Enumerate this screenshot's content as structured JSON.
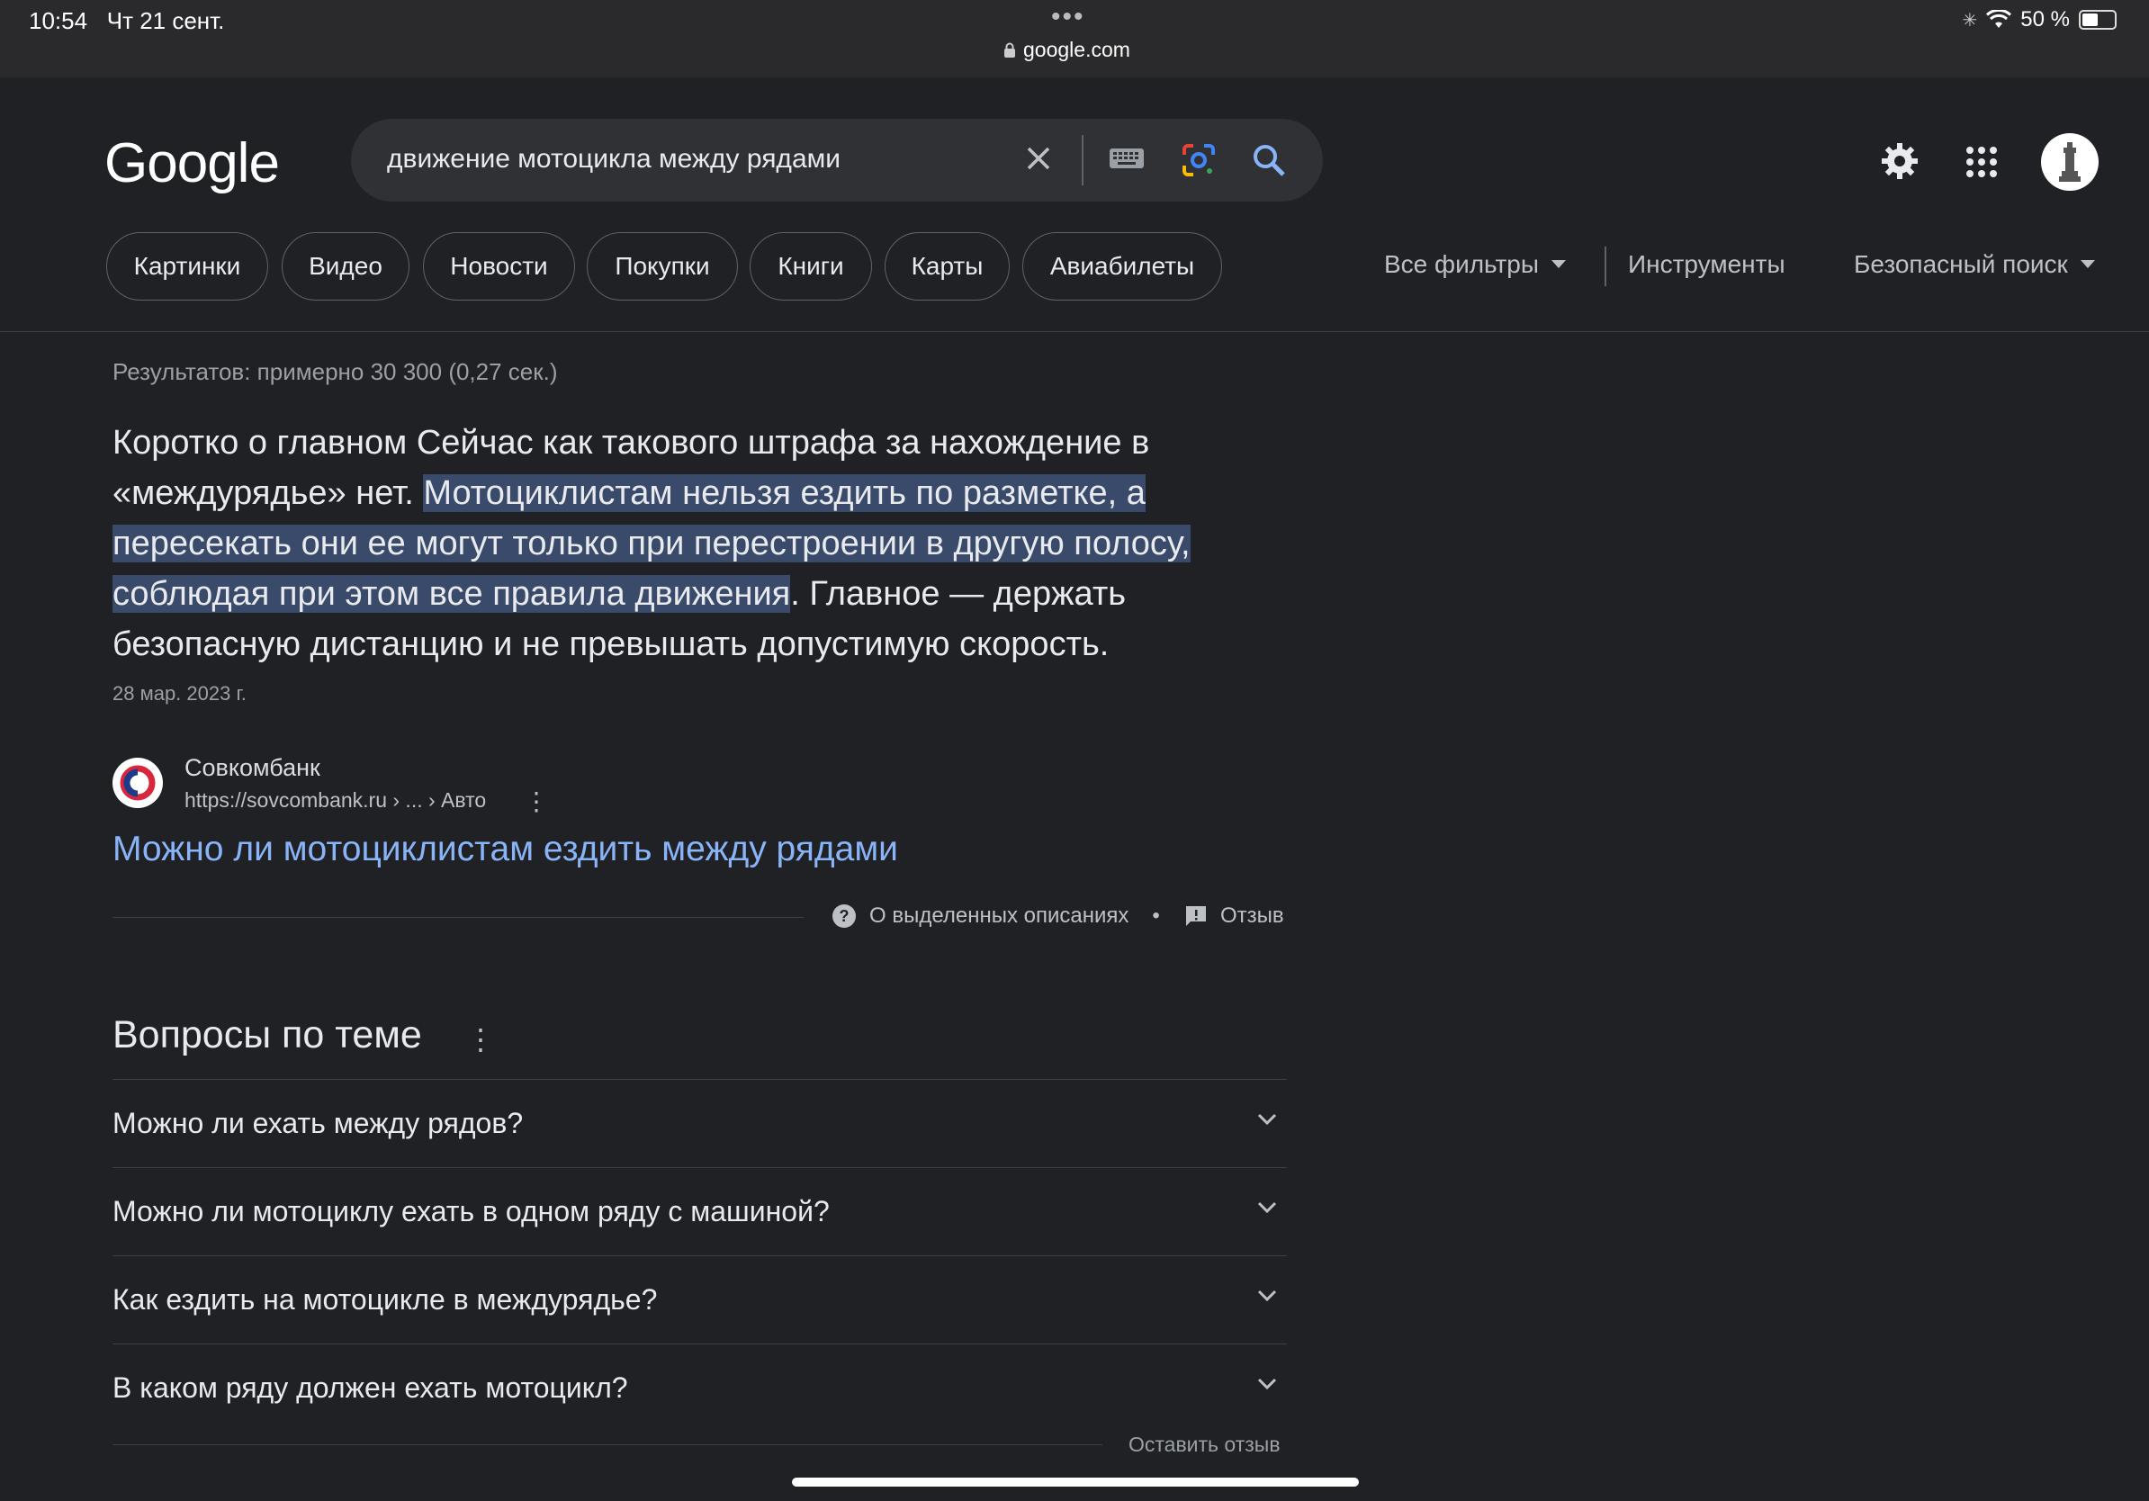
{
  "status_bar": {
    "time_date": "10:54   Чт 21 сент.",
    "url": "google.com",
    "battery": "50 %",
    "battery_level": 0.5
  },
  "header": {
    "logo": "Google",
    "search_value": "движение мотоцикла между рядами",
    "icons": [
      "clear-icon",
      "keyboard-icon",
      "google-lens-icon",
      "search-icon",
      "settings-gear-icon",
      "apps-grid-icon",
      "account-avatar"
    ]
  },
  "chips": [
    "Картинки",
    "Видео",
    "Новости",
    "Покупки",
    "Книги",
    "Карты",
    "Авиабилеты"
  ],
  "tools": {
    "all_filters": "Все фильтры",
    "instruments": "Инструменты",
    "safe_search": "Безопасный поиск"
  },
  "results_stats": "Результатов: примерно 30 300 (0,27 сек.)",
  "featured": {
    "text_before": "Коротко о главном Сейчас как такового штрафа за нахождение в «междурядье» нет. ",
    "text_highlight": "Мотоциклистам нельзя ездить по разметке, а пересекать они ее могут только при перестроении в другую полосу, соблюдая при этом все правила движения",
    "text_after": ". Главное — держать безопасную дистанцию и не превышать допустимую скорость.",
    "date": "28 мар. 2023 г.",
    "source_name": "Совкомбанк",
    "source_url": "https://sovcombank.ru › ... › Авто",
    "link_title": "Можно ли мотоциклистам ездить между рядами",
    "about_label": "О выделенных описаниях",
    "separator": "•",
    "feedback_label": "Отзыв"
  },
  "paa": {
    "title": "Вопросы по теме",
    "questions": [
      "Можно ли ехать между рядов?",
      "Можно ли мотоциклу ехать в одном ряду с машиной?",
      "Как ездить на мотоцикле в междурядье?",
      "В каком ряду должен ехать мотоцикл?"
    ],
    "feedback": "Оставить отзыв"
  },
  "colors": {
    "background": "#202124",
    "link": "#8ab4f8",
    "highlight": "#394a6b"
  }
}
